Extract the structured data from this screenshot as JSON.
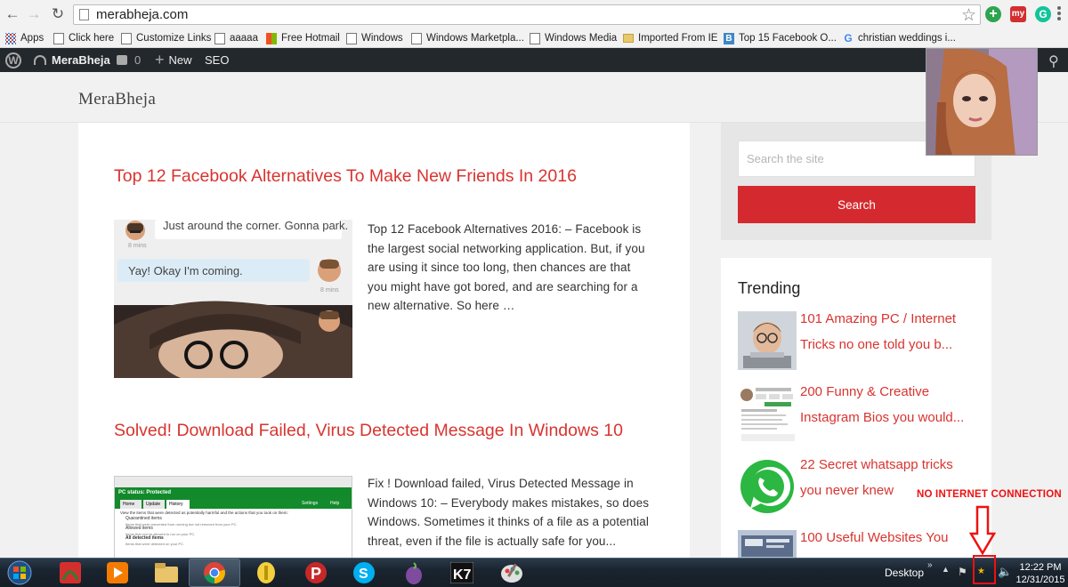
{
  "browser": {
    "url": "merabheja.com",
    "back_icon": "arrow-left",
    "forward_icon": "arrow-right",
    "reload_icon": "reload",
    "star_icon": "star"
  },
  "extensions": [
    {
      "name": "green-plus-extension",
      "label": "+",
      "color": "#2ea44f"
    },
    {
      "name": "my-extension",
      "label": "my",
      "color": "#d32f2f"
    },
    {
      "name": "grammarly-extension",
      "label": "G",
      "color": "#15c39a"
    }
  ],
  "bookmarks": [
    {
      "label": "Apps",
      "icon": "grid"
    },
    {
      "label": "Click here",
      "icon": "page"
    },
    {
      "label": "Customize Links",
      "icon": "page"
    },
    {
      "label": "aaaaa",
      "icon": "page"
    },
    {
      "label": "Free Hotmail",
      "icon": "ms"
    },
    {
      "label": "Windows",
      "icon": "page"
    },
    {
      "label": "Windows Marketpla...",
      "icon": "page"
    },
    {
      "label": "Windows Media",
      "icon": "page"
    },
    {
      "label": "Imported From IE",
      "icon": "folder"
    },
    {
      "label": "Top 15 Facebook O...",
      "icon": "b"
    },
    {
      "label": "christian weddings i...",
      "icon": "g"
    }
  ],
  "adminbar": {
    "site_name": "MeraBheja",
    "comments_count": "0",
    "new_label": "New",
    "seo_label": "SEO"
  },
  "site": {
    "title": "MeraBheja"
  },
  "posts": [
    {
      "title": "Top 12 Facebook Alternatives To Make New Friends In 2016",
      "excerpt": "Top 12 Facebook Alternatives 2016: – Facebook is the largest social networking application. But, if you are using it since too long, then chances are that you might have got bored, and are searching for a new alternative. So here …",
      "thumb": {
        "bubble1": "Just around the corner. Gonna park.",
        "time1": "8 mins",
        "bubble2": "Yay! Okay I'm coming.",
        "time2": "8 mins"
      }
    },
    {
      "title": "Solved! Download Failed, Virus Detected Message In Windows 10",
      "excerpt": "Fix ! Download failed, Virus Detected Message in Windows 10: – Everybody makes mistakes, so does Windows. Sometimes it thinks of a file as a potential threat, even if the file is actually safe for you...",
      "thumb": {
        "status": "PC status: Protected",
        "tabs": [
          "Home",
          "Update",
          "History"
        ],
        "settings": "Settings",
        "help": "Help",
        "desc": "View the items that were detected as potentially harmful and the actions that you took on them:",
        "options": [
          {
            "label": "Quarantined items",
            "sub": "Items that were prevented from running but not removed from your PC."
          },
          {
            "label": "Allowed items",
            "sub": "Items that you've allowed to run on your PC."
          },
          {
            "label": "All detected items",
            "sub": "Items that were detected on your PC."
          }
        ]
      }
    }
  ],
  "sidebar": {
    "search_placeholder": "Search the site",
    "search_button": "Search",
    "trending_title": "Trending",
    "trending": [
      {
        "title": "101 Amazing PC / Internet Tricks no one told you b..."
      },
      {
        "title": "200 Funny & Creative Instagram Bios you would..."
      },
      {
        "title": "22 Secret whatsapp tricks you never knew"
      },
      {
        "title": "100 Useful Websites You"
      }
    ]
  },
  "annotation": {
    "text": "NO INTERNET CONNECTION"
  },
  "taskbar": {
    "desktop_label": "Desktop",
    "time": "12:22 PM",
    "date": "12/31/2015",
    "apps": [
      "start",
      "adobe-reader",
      "media-player",
      "file-explorer",
      "chrome",
      "notes",
      "pdf-app",
      "skype",
      "tor-browser",
      "k7-antivirus",
      "paint"
    ]
  },
  "colors": {
    "accent_red": "#d8342f",
    "button_red": "#d42a2f",
    "adminbar": "#23282d"
  }
}
